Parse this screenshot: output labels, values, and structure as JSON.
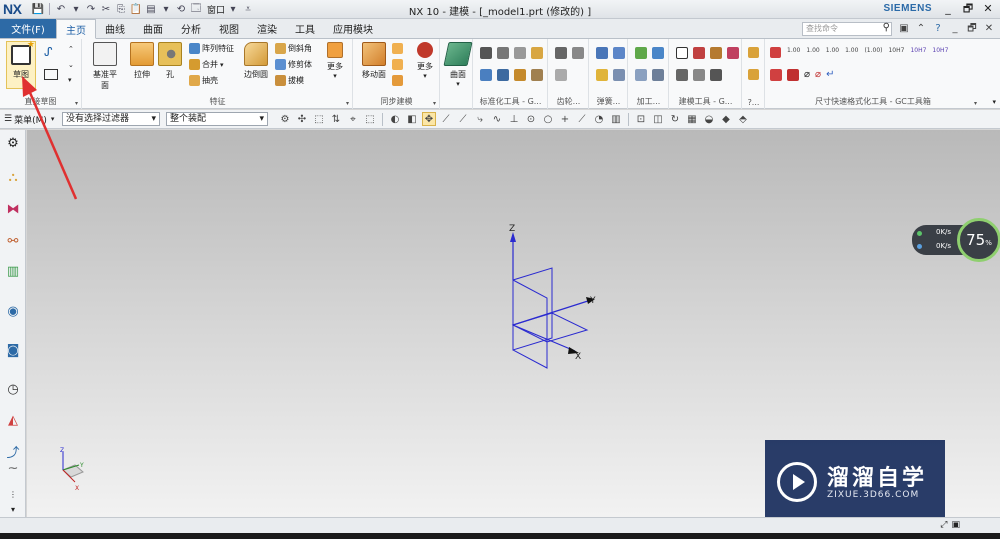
{
  "window": {
    "logo": "NX",
    "title": "NX 10 - 建模 - [_model1.prt  (修改的)  ]",
    "brand": "SIEMENS",
    "window_menu": "窗口",
    "buttons": [
      "_",
      "🗗",
      "✕"
    ]
  },
  "menubar": {
    "file": "文件(F)",
    "tabs": [
      "主页",
      "曲线",
      "曲面",
      "分析",
      "视图",
      "渲染",
      "工具",
      "应用模块"
    ],
    "active_tab": "主页",
    "search_placeholder": "查找命令"
  },
  "ribbon": {
    "sketch_label": "草图",
    "groups": {
      "direct_sketch": "直接草图",
      "feature": "特征",
      "sync": "同步建模",
      "standard": "标准化工具 - G...",
      "gear": "齿轮...",
      "spring": "弹簧...",
      "machining": "加工...",
      "modeling_tool": "建模工具 - G...",
      "more": "?...",
      "dimension": "尺寸快速格式化工具 - GC工具箱"
    },
    "feature_buttons": {
      "datum_plane": "基准平面",
      "extrude": "拉伸",
      "hole": "孔",
      "pattern": "阵列特征",
      "unite": "合并",
      "shell": "抽壳",
      "edge_blend": "边倒圆",
      "chamfer": "倒斜角",
      "trim_body": "修剪体",
      "draft": "拔模",
      "more": "更多"
    },
    "sync_buttons": {
      "move_face": "移动面",
      "more": "更多"
    },
    "surface_button": "曲面",
    "dimension_labels": [
      "1.00",
      "1.00",
      "1.00",
      "1.00",
      "(1.00)",
      "10H7",
      "10H7",
      "10H7"
    ]
  },
  "filterbar": {
    "menu_label": "菜单(M)",
    "filter_value": "没有选择过滤器",
    "assembly_value": "整个装配"
  },
  "viewport": {
    "triad_labels": {
      "z": "Z",
      "y": "Y",
      "x": "X"
    }
  },
  "net_widget": {
    "up": "0K/s",
    "down": "0K/s",
    "percent": "75",
    "percent_unit": "%"
  },
  "watermark": {
    "cn": "溜溜自学",
    "en": "ZIXUE.3D66.COM"
  },
  "colors": {
    "accent": "#2d6aa6",
    "triad": "#2a2ad0",
    "annotation_arrow": "#e03030",
    "watermark_bg": "#182c5c"
  }
}
